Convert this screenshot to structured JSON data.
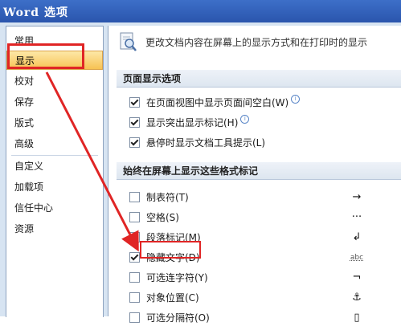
{
  "window": {
    "title": "Word 选项"
  },
  "sidebar": {
    "items": [
      {
        "label": "常用"
      },
      {
        "label": "显示"
      },
      {
        "label": "校对"
      },
      {
        "label": "保存"
      },
      {
        "label": "版式"
      },
      {
        "label": "高级"
      },
      {
        "label": "自定义"
      },
      {
        "label": "加载项"
      },
      {
        "label": "信任中心"
      },
      {
        "label": "资源"
      }
    ],
    "selected": "显示"
  },
  "header": {
    "icon": "magnifier-document-icon",
    "text": "更改文档内容在屏幕上的显示方式和在打印时的显示"
  },
  "page_display": {
    "title": "页面显示选项",
    "options": [
      {
        "label": "在页面视图中显示页面间空白(W)",
        "checked": true,
        "info": true
      },
      {
        "label": "显示突出显示标记(H)",
        "checked": true,
        "info": true
      },
      {
        "label": "悬停时显示文档工具提示(L)",
        "checked": true,
        "info": false
      }
    ]
  },
  "format_marks": {
    "title": "始终在屏幕上显示这些格式标记",
    "options": [
      {
        "label": "制表符(T)",
        "checked": false,
        "glyph": "→"
      },
      {
        "label": "空格(S)",
        "checked": false,
        "glyph": "···"
      },
      {
        "label": "段落标记(M)",
        "checked": false,
        "glyph": "↲"
      },
      {
        "label": "隐藏文字(D)",
        "checked": true,
        "glyph": "abc"
      },
      {
        "label": "可选连字符(Y)",
        "checked": false,
        "glyph": "¬"
      },
      {
        "label": "对象位置(C)",
        "checked": false,
        "glyph": "⚓"
      },
      {
        "label": "可选分隔符(O)",
        "checked": false,
        "glyph": "▯"
      }
    ]
  },
  "colors": {
    "title_bar": "#2a55ad",
    "selected_item": "#f7c252",
    "annotation": "#e02525"
  }
}
